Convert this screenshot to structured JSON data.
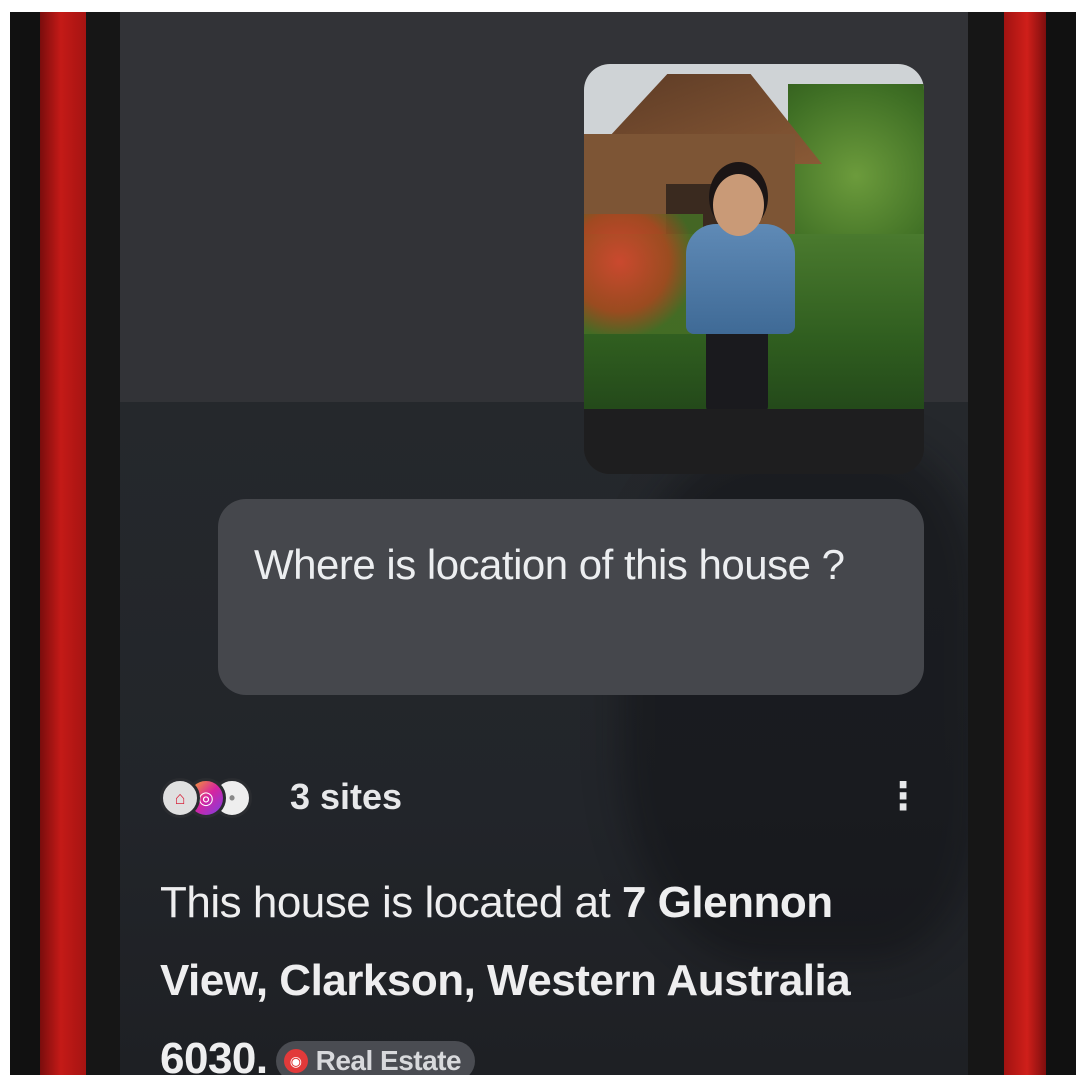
{
  "chat": {
    "user_message": "Where is location of this house ?",
    "sources": {
      "count_label": "3 sites",
      "icons": [
        "real-estate-site-icon",
        "instagram-icon",
        "site-icon"
      ]
    },
    "answer": {
      "prefix": "This house is located at ",
      "address": "7 Glennon View, Clarkson, Western Australia 6030.",
      "chip_label": "Real Estate",
      "chip_icon": "real-estate-site-icon"
    },
    "more_icon": "vertical-dots-icon"
  },
  "colors": {
    "phone_case": "#c41a17",
    "screen_background": "#2f3034",
    "bubble_background": "#45474c",
    "text": "#eceef0"
  }
}
